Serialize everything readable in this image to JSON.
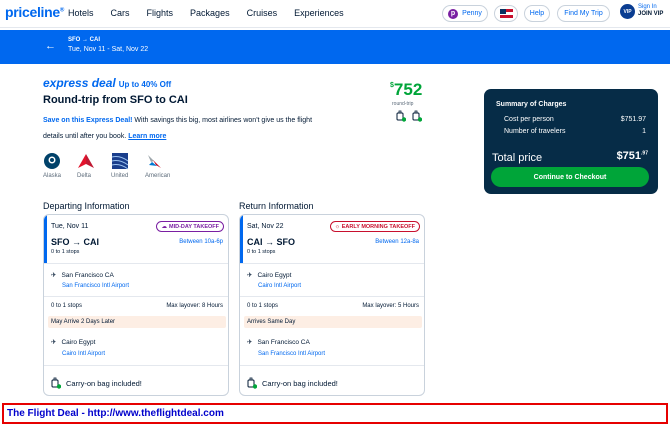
{
  "nav": {
    "logo": "priceline",
    "logo_mark": "®",
    "links": [
      "Hotels",
      "Cars",
      "Flights",
      "Packages",
      "Cruises",
      "Experiences"
    ],
    "penny": "Penny",
    "help": "Help",
    "find_trip": "Find My Trip",
    "vip_badge": "VIP",
    "sign_in": "Sign In",
    "join_vip": "JOIN VIP"
  },
  "banner": {
    "back_glyph": "←",
    "route": "SFO → CAI",
    "dates": "Tue, Nov 11 - Sat, Nov 22"
  },
  "deal": {
    "logo": "express deal",
    "pct": "Up to 40% Off",
    "title": "Round-trip from SFO to CAI",
    "desc_bold": "Save on this Express Deal!",
    "desc_rest": " With savings this big, most airlines won't give us the flight details until after you book.",
    "learn_more": "Learn more",
    "price_sym": "$",
    "price": "752",
    "price_note": "round-trip"
  },
  "airlines": [
    "Alaska",
    "Delta",
    "United",
    "American"
  ],
  "departing": {
    "heading": "Departing Information",
    "date": "Tue, Nov 11",
    "takeoff": "MID-DAY TAKEOFF",
    "route_from": "SFO",
    "route_to": "CAI",
    "between": "Between 10a-6p",
    "stops": "0 to 1 stops",
    "origin_city": "San Francisco CA",
    "origin_airport": "San Francisco Intl Airport",
    "stops2": "0 to 1 stops",
    "layover": "Max layover: 8 Hours",
    "arrive_note": "May Arrive 2 Days Later",
    "dest_city": "Cairo Egypt",
    "dest_airport": "Cairo Intl Airport",
    "carry_on": "Carry-on bag included!"
  },
  "returning": {
    "heading": "Return Information",
    "date": "Sat, Nov 22",
    "takeoff": "EARLY MORNING TAKEOFF",
    "route_from": "CAI",
    "route_to": "SFO",
    "between": "Between 12a-8a",
    "stops": "0 to 1 stops",
    "origin_city": "Cairo Egypt",
    "origin_airport": "Cairo Intl Airport",
    "stops2": "0 to 1 stops",
    "layover": "Max layover: 5 Hours",
    "arrive_note": "Arrives Same Day",
    "dest_city": "San Francisco CA",
    "dest_airport": "San Francisco Intl Airport",
    "carry_on": "Carry-on bag included!"
  },
  "summary": {
    "title": "Summary of Charges",
    "cost_label": "Cost per person",
    "cost_value": "$751.97",
    "travelers_label": "Number of travelers",
    "travelers_value": "1",
    "total_label": "Total price",
    "total_value": "$751",
    "total_cents": ".97",
    "checkout": "Continue to Checkout"
  },
  "footer": "The Flight Deal - http://www.theflightdeal.com",
  "colors": {
    "brand": "#0068ef",
    "green": "#00a539",
    "summary_bg": "#062c47",
    "mid_day": "#7a1fa2",
    "early": "#c8102e"
  }
}
